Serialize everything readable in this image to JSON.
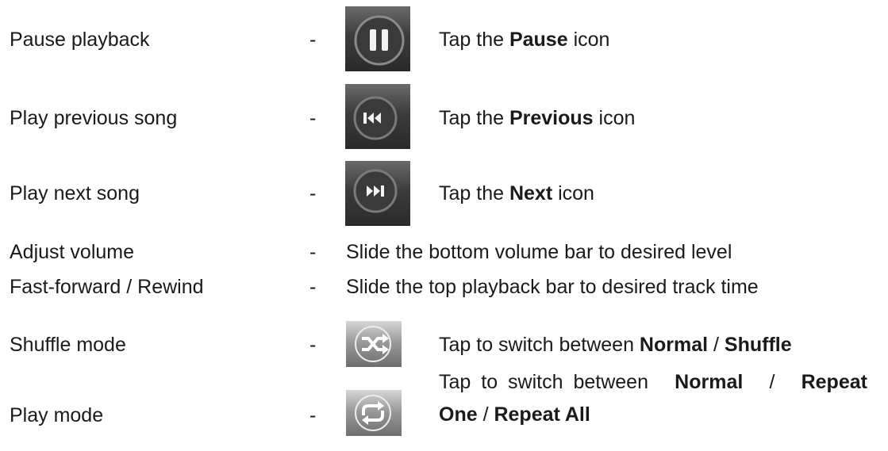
{
  "rows": [
    {
      "action": "Pause playback",
      "dash": "-",
      "icon": "pause-icon",
      "desc_pre": "Tap the ",
      "desc_bold": "Pause",
      "desc_post": " icon"
    },
    {
      "action": "Play previous song",
      "dash": "-",
      "icon": "previous-icon",
      "desc_pre": "Tap the ",
      "desc_bold": "Previous",
      "desc_post": " icon"
    },
    {
      "action": "Play next song",
      "dash": "-",
      "icon": "next-icon",
      "desc_pre": "Tap the ",
      "desc_bold": "Next",
      "desc_post": " icon"
    },
    {
      "action": "Adjust volume",
      "dash": "-",
      "desc": "Slide the bottom volume bar to desired level"
    },
    {
      "action": "Fast-forward / Rewind",
      "dash": "-",
      "desc": "Slide the top playback bar to desired track time"
    },
    {
      "action": "Shuffle mode",
      "dash": "-",
      "icon": "shuffle-icon",
      "desc_pre": "Tap to switch between ",
      "desc_b1": "Normal",
      "desc_sep": " / ",
      "desc_b2": "Shuffle"
    },
    {
      "action": "Play mode",
      "dash": "-",
      "icon": "repeat-icon",
      "desc_line1_pre": "Tap to switch between ",
      "desc_line1_b1": "Normal",
      "desc_line1_sep": " / ",
      "desc_line1_b2": "Repeat",
      "desc_line2_b1": "One",
      "desc_line2_sep": " / ",
      "desc_line2_b2": "Repeat All"
    }
  ]
}
